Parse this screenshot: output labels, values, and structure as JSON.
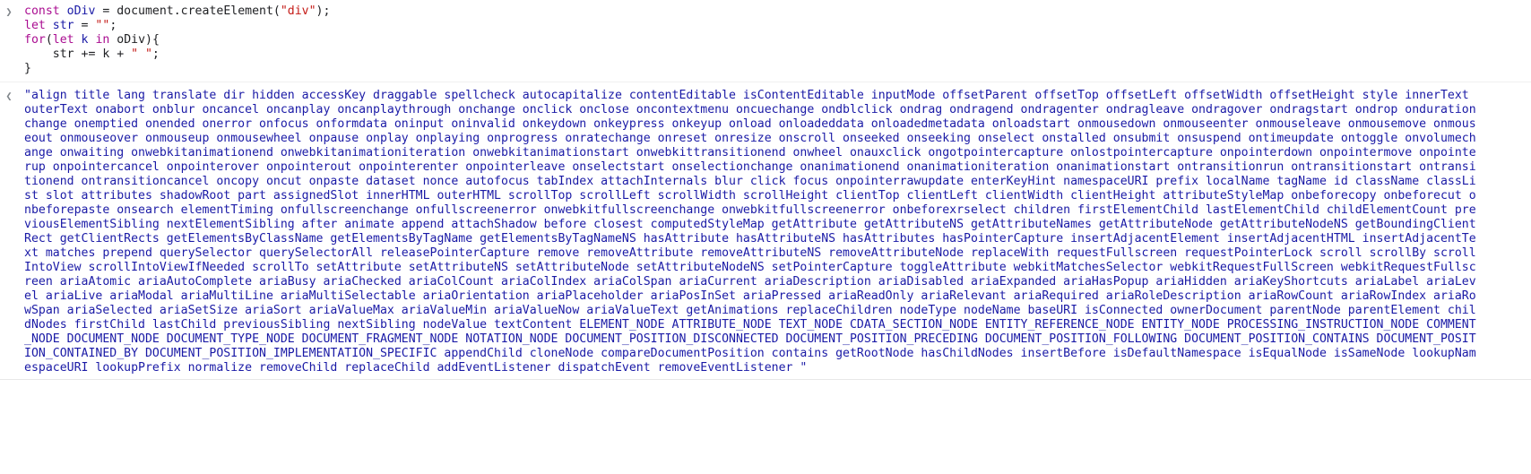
{
  "console": {
    "input_prompt_icon": "chevron-right-icon",
    "output_prompt_icon": "chevron-left-icon",
    "input_lines": [
      [
        {
          "t": "kw",
          "v": "const "
        },
        {
          "t": "var",
          "v": "oDiv"
        },
        {
          "t": "plain",
          "v": " = document.createElement("
        },
        {
          "t": "str",
          "v": "\"div\""
        },
        {
          "t": "plain",
          "v": ");"
        }
      ],
      [
        {
          "t": "kw",
          "v": "let "
        },
        {
          "t": "var",
          "v": "str"
        },
        {
          "t": "plain",
          "v": " = "
        },
        {
          "t": "str",
          "v": "\"\""
        },
        {
          "t": "plain",
          "v": ";"
        }
      ],
      [
        {
          "t": "kw",
          "v": "for"
        },
        {
          "t": "plain",
          "v": "("
        },
        {
          "t": "kw",
          "v": "let "
        },
        {
          "t": "var",
          "v": "k"
        },
        {
          "t": "plain",
          "v": " "
        },
        {
          "t": "kw",
          "v": "in"
        },
        {
          "t": "plain",
          "v": " oDiv){"
        }
      ],
      [
        {
          "t": "plain",
          "v": "    str += k + "
        },
        {
          "t": "str",
          "v": "\" \""
        },
        {
          "t": "plain",
          "v": ";"
        }
      ],
      [
        {
          "t": "plain",
          "v": "}"
        }
      ]
    ],
    "output": "\"align title lang translate dir hidden accessKey draggable spellcheck autocapitalize contentEditable isContentEditable inputMode offsetParent offsetTop offsetLeft offsetWidth offsetHeight style innerText outerText onabort onblur oncancel oncanplay oncanplaythrough onchange onclick onclose oncontextmenu oncuechange ondblclick ondrag ondragend ondragenter ondragleave ondragover ondragstart ondrop ondurationchange onemptied onended onerror onfocus onformdata oninput oninvalid onkeydown onkeypress onkeyup onload onloadeddata onloadedmetadata onloadstart onmousedown onmouseenter onmouseleave onmousemove onmouseout onmouseover onmouseup onmousewheel onpause onplay onplaying onprogress onratechange onreset onresize onscroll onseeked onseeking onselect onstalled onsubmit onsuspend ontimeupdate ontoggle onvolumechange onwaiting onwebkitanimationend onwebkitanimationiteration onwebkitanimationstart onwebkittransitionend onwheel onauxclick ongotpointercapture onlostpointercapture onpointerdown onpointermove onpointerup onpointercancel onpointerover onpointerout onpointerenter onpointerleave onselectstart onselectionchange onanimationend onanimationiteration onanimationstart ontransitionrun ontransitionstart ontransitionend ontransitioncancel oncopy oncut onpaste dataset nonce autofocus tabIndex attachInternals blur click focus onpointerrawupdate enterKeyHint namespaceURI prefix localName tagName id className classList slot attributes shadowRoot part assignedSlot innerHTML outerHTML scrollTop scrollLeft scrollWidth scrollHeight clientTop clientLeft clientWidth clientHeight attributeStyleMap onbeforecopy onbeforecut onbeforepaste onsearch elementTiming onfullscreenchange onfullscreenerror onwebkitfullscreenchange onwebkitfullscreenerror onbeforexrselect children firstElementChild lastElementChild childElementCount previousElementSibling nextElementSibling after animate append attachShadow before closest computedStyleMap getAttribute getAttributeNS getAttributeNames getAttributeNode getAttributeNodeNS getBoundingClientRect getClientRects getElementsByClassName getElementsByTagName getElementsByTagNameNS hasAttribute hasAttributeNS hasAttributes hasPointerCapture insertAdjacentElement insertAdjacentHTML insertAdjacentText matches prepend querySelector querySelectorAll releasePointerCapture remove removeAttribute removeAttributeNS removeAttributeNode replaceWith requestFullscreen requestPointerLock scroll scrollBy scrollIntoView scrollIntoViewIfNeeded scrollTo setAttribute setAttributeNS setAttributeNode setAttributeNodeNS setPointerCapture toggleAttribute webkitMatchesSelector webkitRequestFullScreen webkitRequestFullscreen ariaAtomic ariaAutoComplete ariaBusy ariaChecked ariaColCount ariaColIndex ariaColSpan ariaCurrent ariaDescription ariaDisabled ariaExpanded ariaHasPopup ariaHidden ariaKeyShortcuts ariaLabel ariaLevel ariaLive ariaModal ariaMultiLine ariaMultiSelectable ariaOrientation ariaPlaceholder ariaPosInSet ariaPressed ariaReadOnly ariaRelevant ariaRequired ariaRoleDescription ariaRowCount ariaRowIndex ariaRowSpan ariaSelected ariaSetSize ariaSort ariaValueMax ariaValueMin ariaValueNow ariaValueText getAnimations replaceChildren nodeType nodeName baseURI isConnected ownerDocument parentNode parentElement childNodes firstChild lastChild previousSibling nextSibling nodeValue textContent ELEMENT_NODE ATTRIBUTE_NODE TEXT_NODE CDATA_SECTION_NODE ENTITY_REFERENCE_NODE ENTITY_NODE PROCESSING_INSTRUCTION_NODE COMMENT_NODE DOCUMENT_NODE DOCUMENT_TYPE_NODE DOCUMENT_FRAGMENT_NODE NOTATION_NODE DOCUMENT_POSITION_DISCONNECTED DOCUMENT_POSITION_PRECEDING DOCUMENT_POSITION_FOLLOWING DOCUMENT_POSITION_CONTAINS DOCUMENT_POSITION_CONTAINED_BY DOCUMENT_POSITION_IMPLEMENTATION_SPECIFIC appendChild cloneNode compareDocumentPosition contains getRootNode hasChildNodes insertBefore isDefaultNamespace isEqualNode isSameNode lookupNamespaceURI lookupPrefix normalize removeChild replaceChild addEventListener dispatchEvent removeEventListener \"",
    "colors": {
      "keyword": "#aa0d91",
      "variable": "#1a1aa6",
      "string": "#c41a16",
      "text": "#202124",
      "prompt": "#80868b",
      "result": "#1a1aa6"
    }
  }
}
